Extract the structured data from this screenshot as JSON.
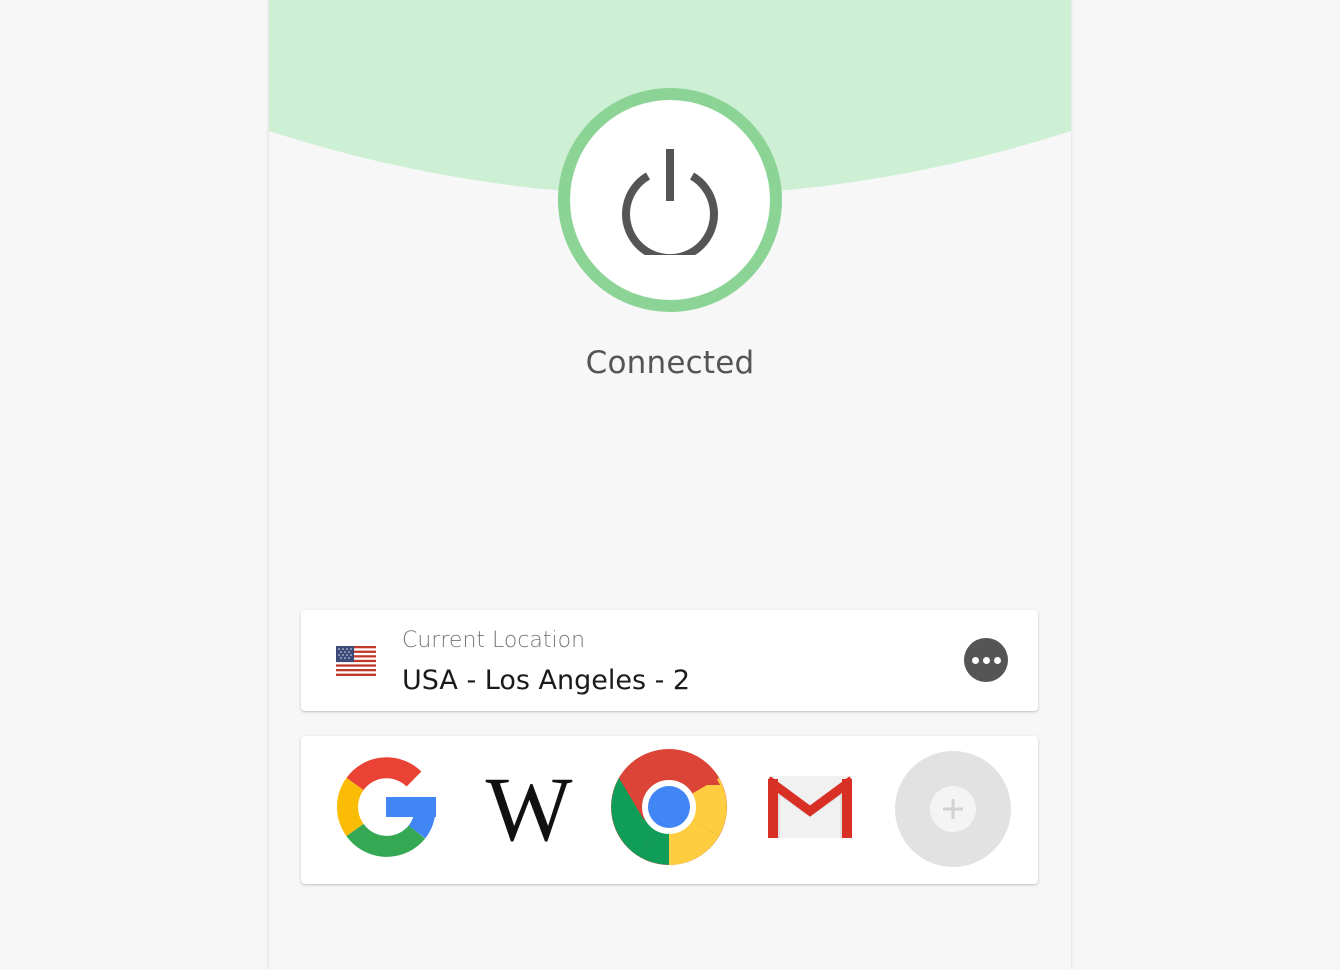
{
  "connection": {
    "status": "Connected",
    "power_button_label": "Disconnect VPN",
    "power_icon": "power-icon"
  },
  "location": {
    "label": "Current Location",
    "value": "USA - Los Angeles - 2",
    "flag_icon": "usa-flag-icon",
    "more_icon": "more-options-icon"
  },
  "shortcuts": [
    {
      "name": "Google",
      "icon": "google-icon"
    },
    {
      "name": "Wikipedia",
      "icon": "wikipedia-icon",
      "glyph": "W"
    },
    {
      "name": "Chrome",
      "icon": "chrome-icon"
    },
    {
      "name": "Gmail",
      "icon": "gmail-icon"
    },
    {
      "name": "Add shortcut",
      "icon": "add-shortcut-icon"
    }
  ],
  "colors": {
    "hero_green": "#cdf0d5",
    "ring_green": "#8cd496",
    "icon_gray": "#555555",
    "background": "#f7f7f7"
  }
}
